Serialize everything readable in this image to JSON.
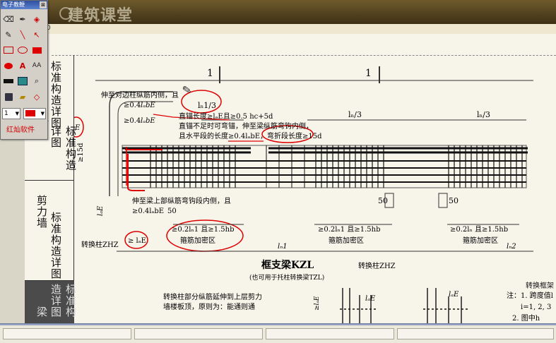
{
  "window": {
    "brand": "建筑课堂",
    "header_frag": "0"
  },
  "palette": {
    "title": "电子教鞭",
    "close": "⊠",
    "line_width": "1",
    "brand": "红灿软件",
    "icons": [
      "eraser-icon",
      "pen-icon",
      "fill-icon",
      "pencil-icon",
      "line-icon",
      "arrow-icon",
      "rect-outline-icon",
      "ellipse-outline-icon",
      "rect-fill-icon",
      "ellipse-fill-icon",
      "text-icon",
      "font-size-icon",
      "black-bar-icon",
      "screen-icon",
      "magnify-icon",
      "save-icon",
      "open-icon",
      "shape-icon"
    ]
  },
  "sidebar": {
    "sections": [
      {
        "label": "标准构造详图"
      },
      {
        "label": "柱"
      },
      {
        "label": "标准构造详图"
      },
      {
        "label": "剪力墙"
      },
      {
        "label": "标准构造详图"
      },
      {
        "label": "梁"
      }
    ]
  },
  "drawing": {
    "num_left": "1",
    "num_right": "1",
    "note_top_1": "伸至对边柱纵筋内侧，且",
    "note_top_2": "≥0.4",
    "labe": "lₐbE",
    "note_top_3": "≥0.4",
    "ln1_3": "lₙ1/3",
    "ln_3": "lₙ/3",
    "note_c1": "直锚长度≥lₐE且≥0.5 hc+5d",
    "note_c2": "直锚不足时可弯锚，伸至梁纵筋弯钩内侧，",
    "note_c3": "且水平段的长度≥0.4lₐbE，弯折段长度≥15d",
    "lae_left": "lₐE",
    "fifteen_d": "≥15d",
    "le_side": "lₐE",
    "note_mid_1": "伸至梁上部纵筋弯钩段内侧，且",
    "note_mid_2": "≥0.4lₐbE",
    "num_50_a": "50",
    "num_50_b": "50",
    "num_50_c": "50",
    "dense1": "≥0.2lₙ1 且≥1.5hb",
    "dense1_label": "箍筋加密区",
    "dense2": "≥0.2lₙ1 且≥1.5hb",
    "dense2_label": "箍筋加密区",
    "dense3": "≥0.2lₙ 且≥1.5hb",
    "dense3_label": "箍筋加密区",
    "zhz_left": "转换柱ZHZ",
    "zhz_mid": "转换柱ZHZ",
    "lae_bottom": "≥ lₐE",
    "ln1": "lₙ1",
    "ln2": "lₙ2",
    "title": "框支梁KZL",
    "subtitle": "(也可用于托柱转换梁TZL)",
    "bottom_note_1": "转换柱部分纵筋延伸到上层剪力",
    "bottom_note_2": "墙楼板顶，原则为：能通则通",
    "bottom_lae": "lₐE",
    "bottom_lae_2": "lₐE",
    "lae_small": "≥lₐE",
    "note_right_1": "注：1. 跨度值l",
    "note_right_2": "i=1, 2, 3",
    "note_right_3": "2. 图中h",
    "label_right_bottom": "转换框架"
  }
}
